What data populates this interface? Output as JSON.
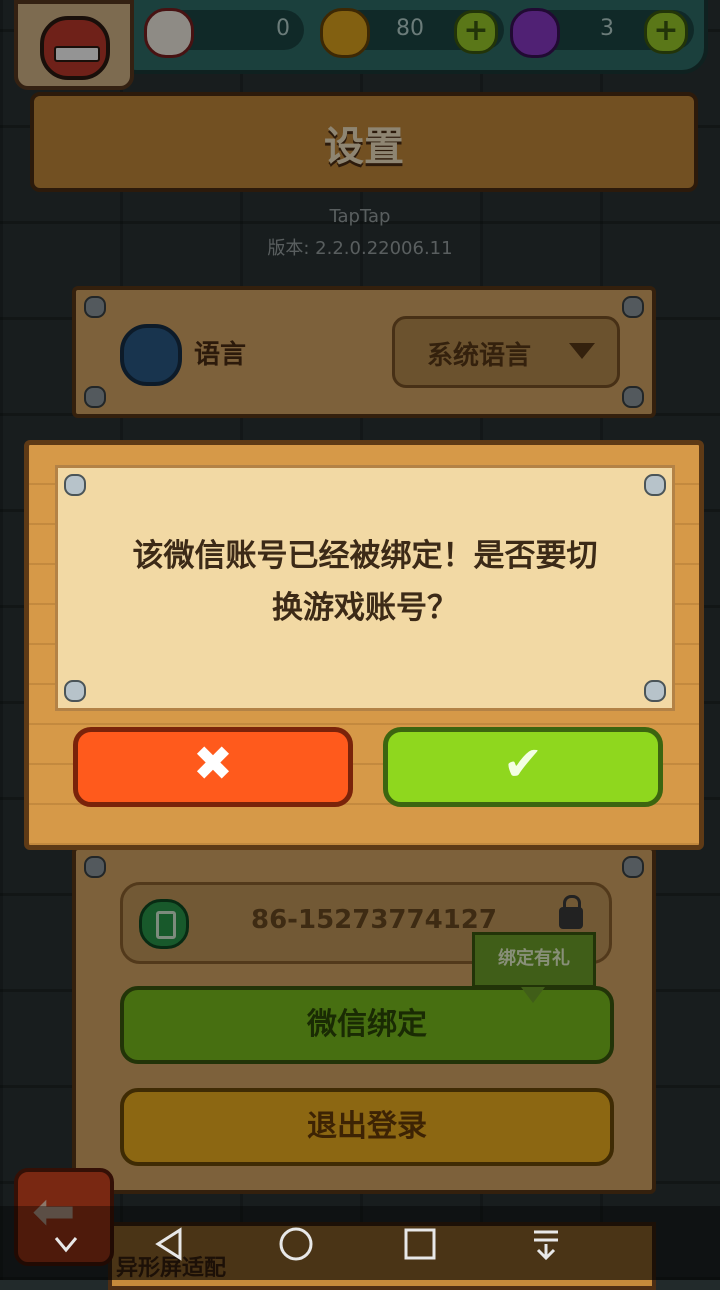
{
  "resources": {
    "eyes": "0",
    "coins": "80",
    "potions": "3"
  },
  "header": {
    "title": "设置"
  },
  "app_info": {
    "channel": "TapTap",
    "version": "版本: 2.2.0.22006.11"
  },
  "language": {
    "label": "语言",
    "value": "系统语言"
  },
  "dialog": {
    "message_line1": "该微信账号已经被绑定！是否要切",
    "message_line2": "换游戏账号？",
    "cancel_icon": "✖",
    "confirm_icon": "✔"
  },
  "account": {
    "phone": "86-15273774127",
    "bind_reward_tag": "绑定有礼",
    "wechat_bind": "微信绑定",
    "logout": "退出登录"
  },
  "bottom": {
    "label": "异形屏适配"
  },
  "colors": {
    "accent_green": "#8fd71e",
    "accent_orange": "#ff5a1c",
    "wood": "#d69948"
  }
}
